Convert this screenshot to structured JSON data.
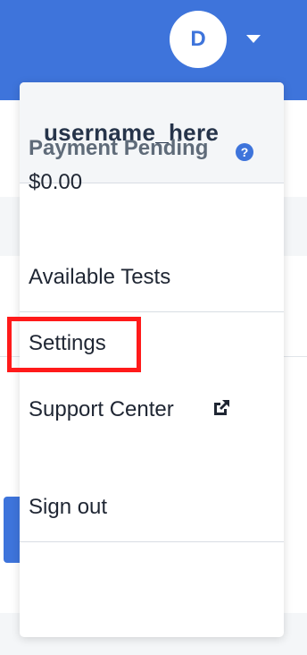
{
  "header": {
    "avatar_initial": "D",
    "avatar_icon": "avatar",
    "menu_toggle_icon": "caret-down-icon",
    "brand_color": "#3e74db"
  },
  "menu": {
    "username": "username_here",
    "payment": {
      "label": "Payment Pending",
      "help_icon": "help-icon",
      "help_glyph": "?",
      "amount": "$0.00"
    },
    "links": {
      "available_tests": "Available Tests",
      "settings": "Settings",
      "support_center": "Support Center",
      "support_icon": "external-link-icon"
    },
    "sign_out": "Sign out"
  },
  "annotation": {
    "highlight_color": "#ff1a1a",
    "highlighted_item": "settings"
  }
}
